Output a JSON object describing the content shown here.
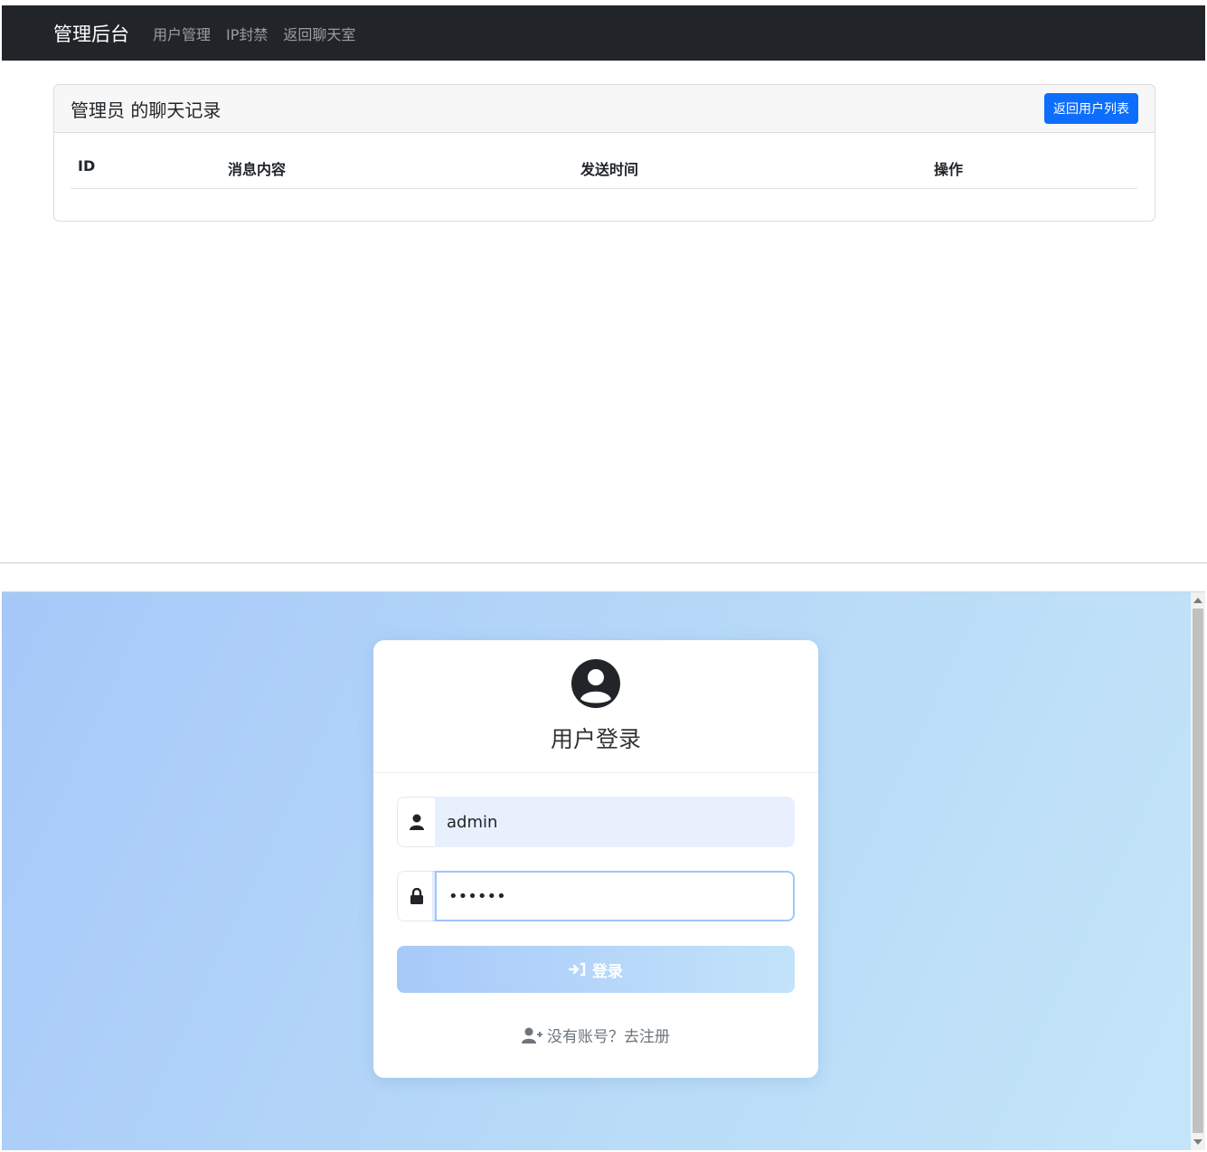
{
  "admin": {
    "navbar": {
      "brand": "管理后台",
      "links": [
        "用户管理",
        "IP封禁",
        "返回聊天室"
      ]
    },
    "card": {
      "title": "管理员 的聊天记录",
      "back_button": "返回用户列表",
      "columns": [
        "ID",
        "消息内容",
        "发送时间",
        "操作"
      ]
    }
  },
  "login": {
    "title": "用户登录",
    "username_value": "admin",
    "password_value": "••••••",
    "submit_label": "登录",
    "register_text": "没有账号？去注册",
    "icons": [
      "user-circle-icon",
      "user-icon",
      "lock-icon",
      "sign-in-icon",
      "user-plus-icon"
    ]
  }
}
